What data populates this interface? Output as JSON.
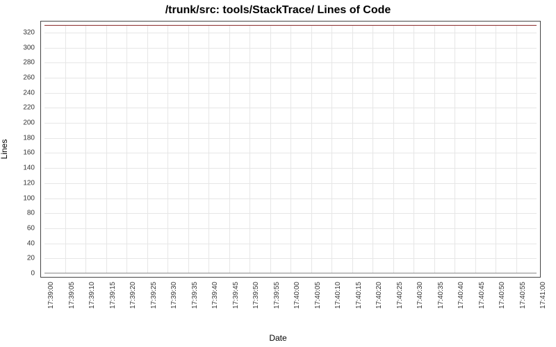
{
  "chart_data": {
    "type": "line",
    "title": "/trunk/src: tools/StackTrace/ Lines of Code",
    "xlabel": "Date",
    "ylabel": "Lines",
    "ylim": [
      0,
      330
    ],
    "y_ticks": [
      0,
      20,
      40,
      60,
      80,
      100,
      120,
      140,
      160,
      180,
      200,
      220,
      240,
      260,
      280,
      300,
      320
    ],
    "x": [
      "17:39:00",
      "17:39:05",
      "17:39:10",
      "17:39:15",
      "17:39:20",
      "17:39:25",
      "17:39:30",
      "17:39:35",
      "17:39:40",
      "17:39:45",
      "17:39:50",
      "17:39:55",
      "17:40:00",
      "17:40:05",
      "17:40:10",
      "17:40:15",
      "17:40:20",
      "17:40:25",
      "17:40:30",
      "17:40:35",
      "17:40:40",
      "17:40:45",
      "17:40:50",
      "17:40:55",
      "17:41:00"
    ],
    "series": [
      {
        "name": "Lines of Code",
        "values": []
      }
    ],
    "grid": true,
    "legend": false
  }
}
